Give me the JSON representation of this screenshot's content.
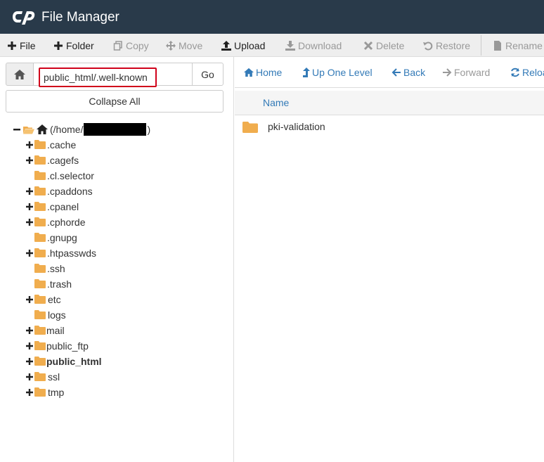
{
  "app": {
    "title": "File Manager"
  },
  "toolbar": {
    "file": "File",
    "folder": "Folder",
    "copy": "Copy",
    "move": "Move",
    "upload": "Upload",
    "download": "Download",
    "delete": "Delete",
    "restore": "Restore",
    "rename": "Rename"
  },
  "path": {
    "value": "public_html/.well-known",
    "go": "Go"
  },
  "sidebar": {
    "collapse_all": "Collapse All",
    "root_prefix": "(/home/",
    "root_suffix": ")",
    "items": [
      {
        "label": ".cache",
        "expandable": true
      },
      {
        "label": ".cagefs",
        "expandable": true
      },
      {
        "label": ".cl.selector",
        "expandable": false
      },
      {
        "label": ".cpaddons",
        "expandable": true
      },
      {
        "label": ".cpanel",
        "expandable": true
      },
      {
        "label": ".cphorde",
        "expandable": true
      },
      {
        "label": ".gnupg",
        "expandable": false
      },
      {
        "label": ".htpasswds",
        "expandable": true
      },
      {
        "label": ".ssh",
        "expandable": false
      },
      {
        "label": ".trash",
        "expandable": false
      },
      {
        "label": "etc",
        "expandable": true
      },
      {
        "label": "logs",
        "expandable": false
      },
      {
        "label": "mail",
        "expandable": true
      },
      {
        "label": "public_ftp",
        "expandable": true
      },
      {
        "label": "public_html",
        "expandable": true
      },
      {
        "label": "ssl",
        "expandable": true
      },
      {
        "label": "tmp",
        "expandable": true
      }
    ]
  },
  "nav": {
    "home": "Home",
    "up_one_level": "Up One Level",
    "back": "Back",
    "forward": "Forward",
    "reload": "Reload"
  },
  "list": {
    "column_name": "Name",
    "rows": [
      {
        "name": "pki-validation"
      }
    ]
  },
  "colors": {
    "titlebar": "#293a4a",
    "folder": "#f0ad4e",
    "link": "#337ab7",
    "highlight_border": "#d0021b",
    "disabled": "#999999"
  }
}
